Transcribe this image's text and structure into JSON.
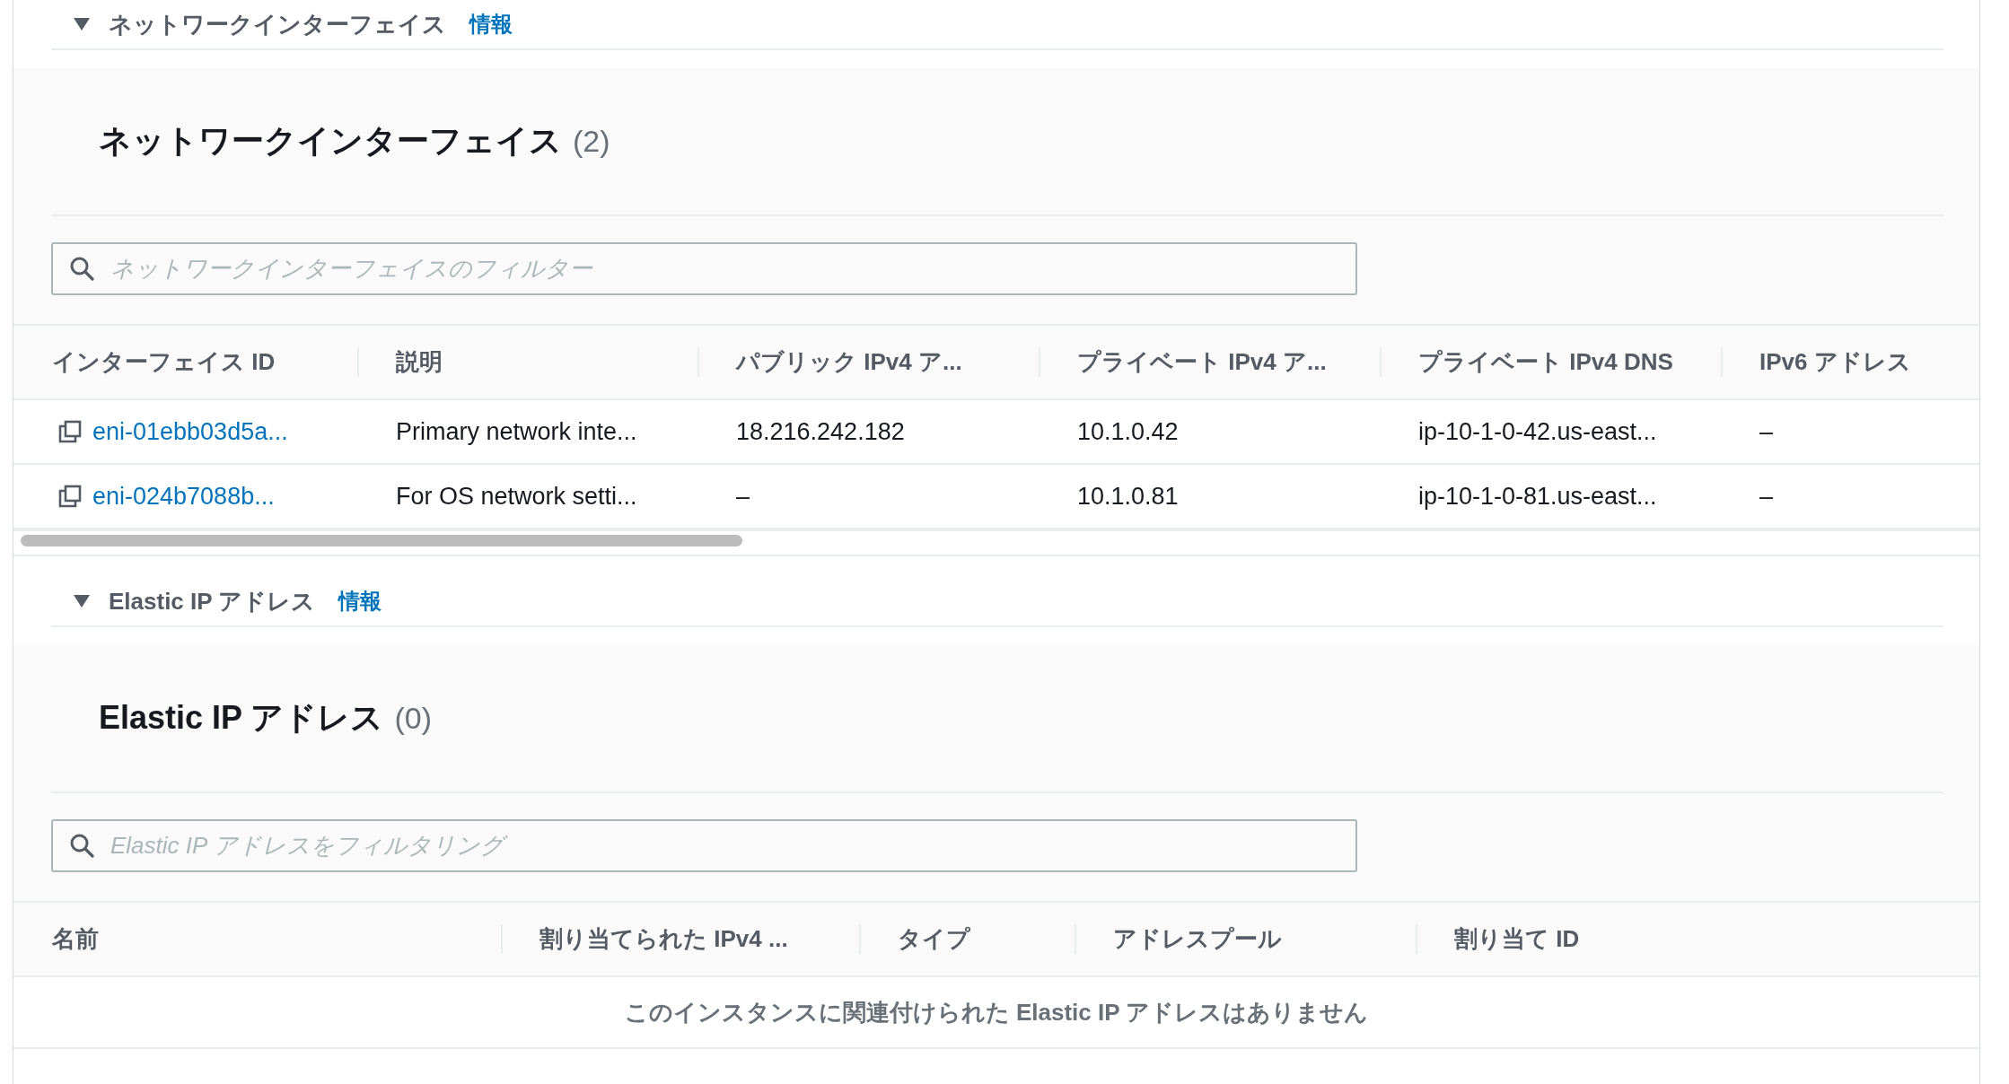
{
  "sections": [
    {
      "header": "ネットワークインターフェイス",
      "info_link": "情報",
      "expanded": true,
      "title": "ネットワークインターフェイス",
      "count": "(2)",
      "filter": {
        "placeholder": "ネットワークインターフェイスのフィルター"
      },
      "columns": [
        "インターフェイス ID",
        "説明",
        "パブリック IPv4 ア...",
        "プライベート IPv4 ア...",
        "プライベート IPv4 DNS",
        "IPv6 アドレス"
      ],
      "rows": [
        {
          "cells": [
            {
              "kind": "link",
              "text": "eni-01ebb03d5a..."
            },
            {
              "kind": "text",
              "text": "Primary network inte..."
            },
            {
              "kind": "text",
              "text": "18.216.242.182"
            },
            {
              "kind": "text",
              "text": "10.1.0.42"
            },
            {
              "kind": "text",
              "text": "ip-10-1-0-42.us-east..."
            },
            {
              "kind": "text",
              "text": "–"
            }
          ]
        },
        {
          "cells": [
            {
              "kind": "link",
              "text": "eni-024b7088b..."
            },
            {
              "kind": "text",
              "text": "For OS network setti..."
            },
            {
              "kind": "text",
              "text": "–"
            },
            {
              "kind": "text",
              "text": "10.1.0.81"
            },
            {
              "kind": "text",
              "text": "ip-10-1-0-81.us-east..."
            },
            {
              "kind": "text",
              "text": "–"
            }
          ]
        }
      ]
    },
    {
      "header": "Elastic IP アドレス",
      "info_link": "情報",
      "expanded": true,
      "title": "Elastic IP アドレス",
      "count": "(0)",
      "filter": {
        "placeholder": "Elastic IP アドレスをフィルタリング"
      },
      "columns": [
        "名前",
        "割り当てられた IPv4 ...",
        "タイプ",
        "アドレスプール",
        "割り当て ID"
      ],
      "empty_message": "このインスタンスに関連付けられた Elastic IP アドレスはありません"
    }
  ]
}
